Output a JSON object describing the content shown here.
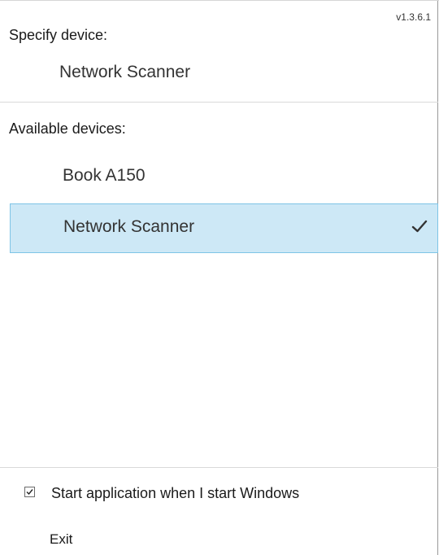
{
  "app": {
    "version": "v1.3.6.1"
  },
  "specify": {
    "label": "Specify device:",
    "current_device": "Network Scanner"
  },
  "available": {
    "label": "Available devices:",
    "devices": [
      {
        "name": "Book A150",
        "selected": false
      },
      {
        "name": "Network Scanner",
        "selected": true,
        "icon": "checkmark-icon"
      }
    ]
  },
  "startup": {
    "label": "Start application when I start Windows",
    "checked": true
  },
  "exit": {
    "label": "Exit"
  },
  "colors": {
    "selected_background": "#cde8f6",
    "selected_border": "#7ec4e6"
  }
}
